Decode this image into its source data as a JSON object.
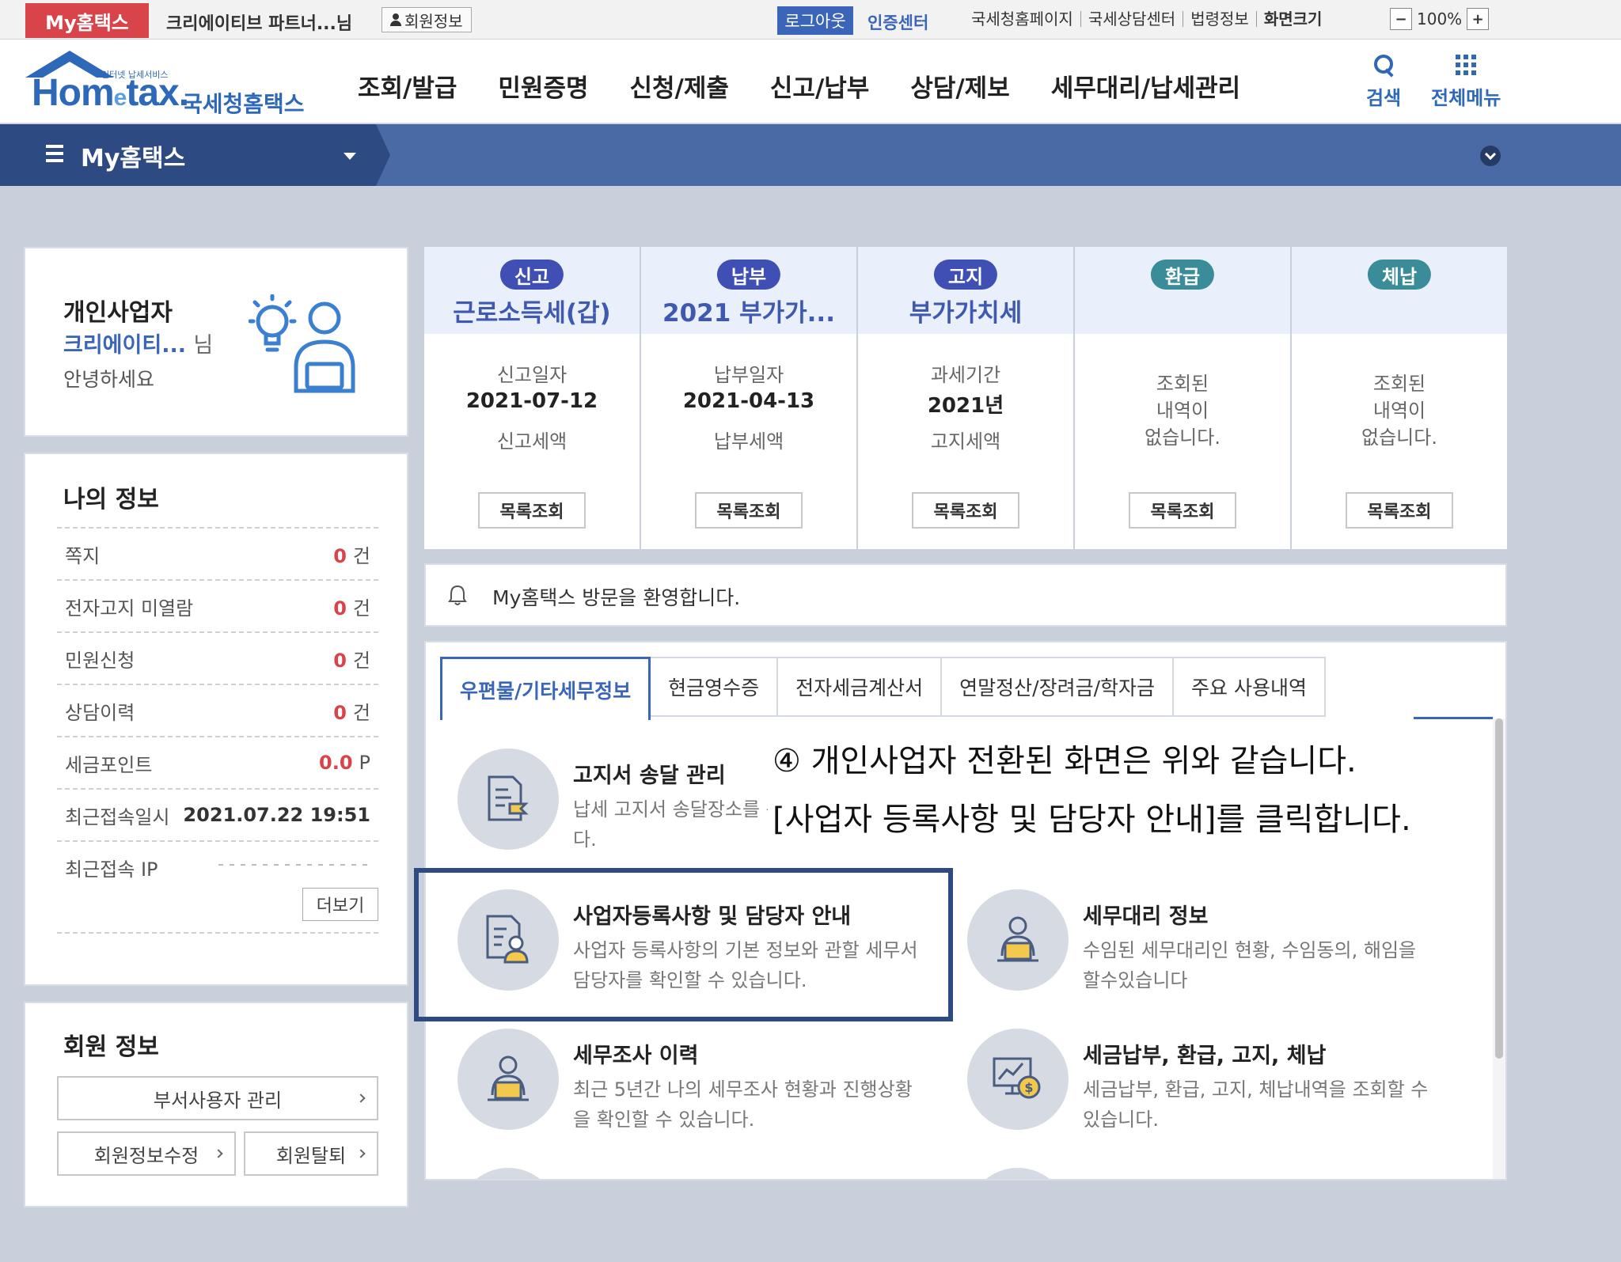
{
  "topbar": {
    "myhome": "My홈택스",
    "user": "크리에이티브 파트너...님",
    "member_info": "회원정보",
    "logout": "로그아웃",
    "cert_center": "인증센터",
    "links": [
      "국세청홈페이지",
      "국세상담센터",
      "법령정보",
      "화면크기"
    ],
    "zoom_minus": "−",
    "zoom_value": "100%",
    "zoom_plus": "+"
  },
  "header": {
    "logo_small": "인터넷 납세서비스",
    "logo_word_a": "Hom",
    "logo_word_e": "e",
    "logo_word_b": "tax.",
    "logo_korean": "국세청홈택스",
    "menu": [
      "조회/발급",
      "민원증명",
      "신청/제출",
      "신고/납부",
      "상담/제보",
      "세무대리/납세관리"
    ],
    "search": "검색",
    "all_menu": "전체메뉴"
  },
  "navbar": {
    "title": "My홈택스"
  },
  "profile": {
    "role": "개인사업자",
    "name": "크리에이티...",
    "suffix": "님",
    "greeting": "안녕하세요"
  },
  "my_info": {
    "title": "나의 정보",
    "rows": [
      {
        "label": "쪽지",
        "value": "0",
        "unit": "건"
      },
      {
        "label": "전자고지 미열람",
        "value": "0",
        "unit": "건"
      },
      {
        "label": "민원신청",
        "value": "0",
        "unit": "건"
      },
      {
        "label": "상담이력",
        "value": "0",
        "unit": "건"
      },
      {
        "label": "세금포인트",
        "value": "0.0",
        "unit": "P"
      },
      {
        "label": "최근접속일시",
        "date": "2021.07.22 19:51"
      },
      {
        "label": "최근접속 IP"
      }
    ],
    "more": "더보기"
  },
  "member_info": {
    "title": "회원 정보",
    "sub_user": "부서사용자 관리",
    "edit": "회원정보수정",
    "withdraw": "회원탈퇴"
  },
  "summary": [
    {
      "badge": "신고",
      "title": "근로소득세(갑)",
      "label1": "신고일자",
      "value": "2021-07-12",
      "label2": "신고세액",
      "button": "목록조회"
    },
    {
      "badge": "납부",
      "title": "2021 부가가...",
      "label1": "납부일자",
      "value": "2021-04-13",
      "label2": "납부세액",
      "button": "목록조회"
    },
    {
      "badge": "고지",
      "title": "부가가치세",
      "label1": "과세기간",
      "value": "2021년",
      "label2": "고지세액",
      "button": "목록조회"
    },
    {
      "badge": "환급",
      "empty": "조회된\n내역이\n없습니다.",
      "button": "목록조회"
    },
    {
      "badge": "체납",
      "empty": "조회된\n내역이\n없습니다.",
      "button": "목록조회"
    }
  ],
  "welcome": "My홈택스 방문을 환영합니다.",
  "tabs": [
    "우편물/기타세무정보",
    "현금영수증",
    "전자세금계산서",
    "연말정산/장려금/학자금",
    "주요 사용내역"
  ],
  "services": {
    "notice": {
      "name": "고지서 송달 관리",
      "desc": "납세 고지서 송달장소를 관리할 수 있습니다."
    },
    "biz": {
      "name": "사업자등록사항 및 담당자 안내",
      "desc": "사업자 등록사항의 기본 정보와 관할 세무서 담당자를 확인할 수 있습니다."
    },
    "agent": {
      "name": "세무대리 정보",
      "desc": "수임된 세무대리인 현황, 수임동의, 해임을 할수있습니다"
    },
    "audit": {
      "name": "세무조사 이력",
      "desc": "최근 5년간 나의 세무조사 현황과 진행상황을 확인할 수 있습니다."
    },
    "payment": {
      "name": "세금납부, 환급, 고지, 체납",
      "desc": "세금납부, 환급, 고지, 체납내역을 조회할 수 있습니다."
    }
  },
  "annotation": {
    "line1": "④ 개인사업자 전환된 화면은 위와 같습니다.",
    "line2": "[사업자 등록사항 및 담당자 안내]를 클릭합니다."
  }
}
